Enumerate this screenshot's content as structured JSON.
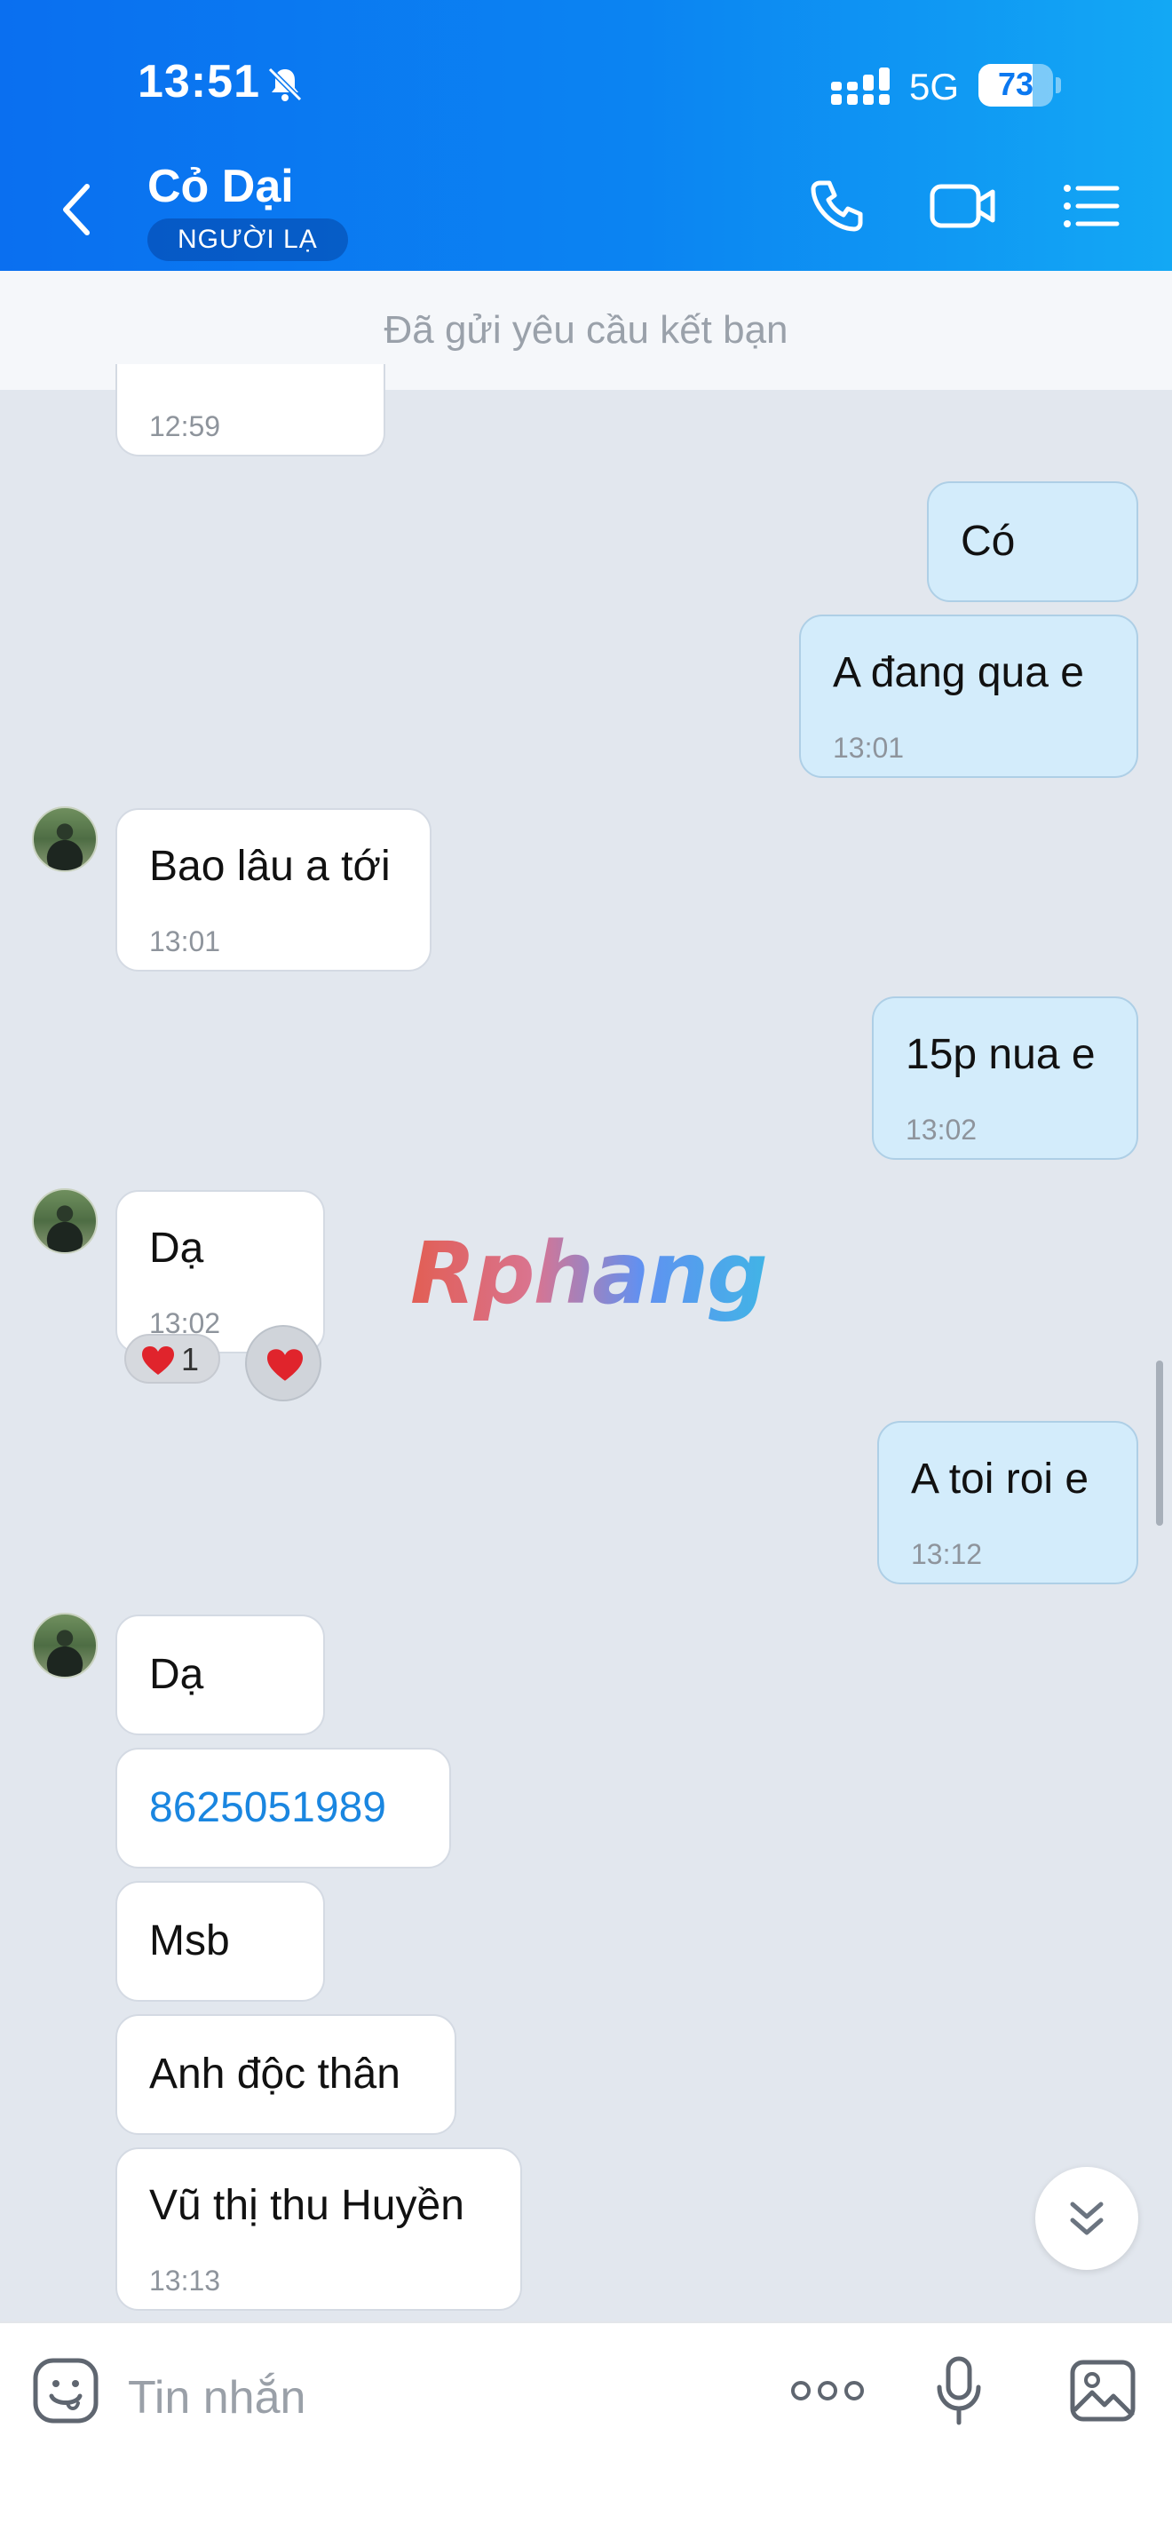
{
  "status_bar": {
    "time": "13:51",
    "network": "5G",
    "battery": "73",
    "battery_level": 0.73
  },
  "header": {
    "contact_name": "Cỏ Dại",
    "badge": "NGƯỜI LẠ"
  },
  "friend_request": "Đã gửi yêu cầu kết bạn",
  "messages": [
    {
      "side": "in",
      "time": "12:59"
    },
    {
      "side": "out",
      "text": "Có"
    },
    {
      "side": "out",
      "text": "A đang qua e",
      "time": "13:01"
    },
    {
      "side": "in",
      "text": "Bao lâu a tới",
      "time": "13:01"
    },
    {
      "side": "out",
      "text": "15p nua e",
      "time": "13:02"
    },
    {
      "side": "in",
      "text": "Dạ",
      "time": "13:02",
      "reaction_count": "1"
    },
    {
      "side": "out",
      "text": "A toi roi e",
      "time": "13:12"
    },
    {
      "side": "in",
      "text": "Dạ"
    },
    {
      "side": "in",
      "text": "8625051989"
    },
    {
      "side": "in",
      "text": "Msb"
    },
    {
      "side": "in",
      "text": "Anh độc thân"
    },
    {
      "side": "in",
      "text": "Vũ thị thu Huyền",
      "time": "13:13"
    }
  ],
  "watermark": "Rphang",
  "input": {
    "placeholder": "Tin nhắn"
  },
  "icons": [
    "back-arrow-icon",
    "phone-icon",
    "video-call-icon",
    "menu-list-icon",
    "bell-mute-icon",
    "emoji-icon",
    "more-icon",
    "microphone-icon",
    "image-icon",
    "chevron-double-down-icon",
    "heart-icon"
  ],
  "colors": {
    "header_start": "#0a6ff0",
    "header_end": "#13a8f4",
    "outgoing_bubble": "#d3ecfb",
    "incoming_bubble": "#ffffff",
    "background": "#e2e7ee",
    "link": "#1a86e0"
  }
}
